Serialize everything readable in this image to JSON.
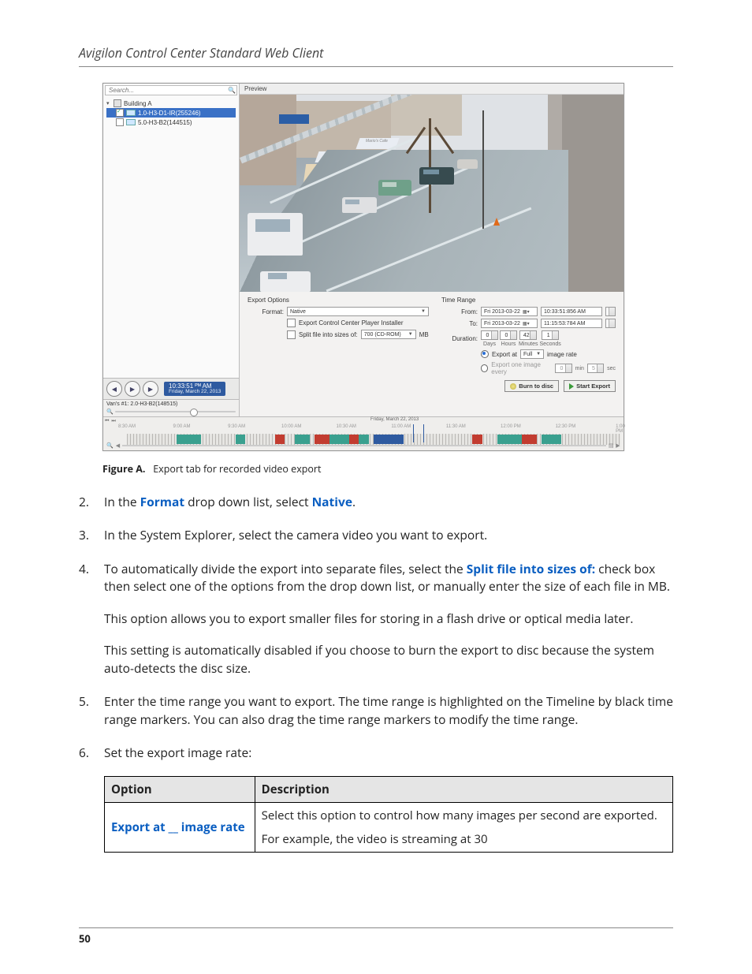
{
  "header": {
    "title": "Avigilon Control Center Standard Web Client"
  },
  "app": {
    "search_placeholder": "Search...",
    "tree": {
      "root": "Building A",
      "items": [
        {
          "label": "1.0-H3-D1-IR(255246)",
          "checked": true
        },
        {
          "label": "5.0-H3-B2(144515)",
          "checked": false
        }
      ]
    },
    "playback": {
      "time": "10:33:51 ᴾᴹ AM",
      "date": "Friday, March 22, 2013"
    },
    "footer_cam": "Van's #1: 2.0-H3-B2(148515)",
    "preview_label": "Preview",
    "export_options": {
      "title": "Export Options",
      "format_label": "Format:",
      "format_value": "Native",
      "player_cb": "Export Control Center Player Installer",
      "split_cb": "Split file into sizes of:",
      "split_value": "700 (CD-ROM)",
      "split_unit": "MB"
    },
    "time_range": {
      "title": "Time Range",
      "from_label": "From:",
      "from_date": "Fri 2013-03-22",
      "from_time": "10:33:51:856 AM",
      "to_label": "To:",
      "to_date": "Fri 2013-03-22",
      "to_time": "11:15:53:784 AM",
      "duration_label": "Duration:",
      "dur_days": "0",
      "dur_hours": "0",
      "dur_min": "42",
      "dur_sec": "1",
      "dur_days_l": "Days",
      "dur_hours_l": "Hours",
      "dur_min_l": "Minutes",
      "dur_sec_l": "Seconds",
      "rate_opt": "Export at",
      "rate_val": "Full",
      "rate_suffix": "image rate",
      "one_opt": "Export one image every",
      "one_v1": "0",
      "one_u1": "min",
      "one_v2": "5",
      "one_u2": "sec"
    },
    "buttons": {
      "burn": "Burn to disc",
      "start": "Start Export"
    },
    "timeline": {
      "date": "Friday, March 22, 2013",
      "ticks": [
        "8:30 AM",
        "9:00 AM",
        "9:30 AM",
        "10:00 AM",
        "10:30 AM",
        "11:00 AM",
        "11:30 AM",
        "12:00 PM",
        "12:30 PM",
        "1:00 PM"
      ]
    }
  },
  "caption": {
    "prefix": "Figure A.",
    "text": "Export tab for recorded video export"
  },
  "steps": {
    "s2": {
      "n": "2.",
      "a": "In the ",
      "kw1": "Format",
      "b": " drop down list, select ",
      "kw2": "Native",
      "c": "."
    },
    "s3": {
      "n": "3.",
      "t": "In the System Explorer, select the camera video you want to export."
    },
    "s4": {
      "n": "4.",
      "a": "To automatically divide the export into separate files, select the ",
      "kw": "Split file into sizes of:",
      "b": " check box then select one of the options from the drop down list, or manually enter the size of each file in MB.",
      "p2": "This option allows you to export smaller files for storing in a flash drive or optical media later.",
      "p3": "This setting is automatically disabled if you choose to burn the export to disc because the system auto-detects the disc size."
    },
    "s5": {
      "n": "5.",
      "t": "Enter the time range you want to export. The time range is highlighted on the Timeline by black time range markers. You can also drag the time range markers to modify the time range."
    },
    "s6": {
      "n": "6.",
      "t": "Set the export image rate:"
    }
  },
  "table": {
    "h1": "Option",
    "h2": "Description",
    "r1_opt": "Export at __ image rate",
    "r1_p1": "Select this option to control how many images per second are exported.",
    "r1_p2": "For example, the video is streaming at 30"
  },
  "footer": {
    "page": "50"
  }
}
